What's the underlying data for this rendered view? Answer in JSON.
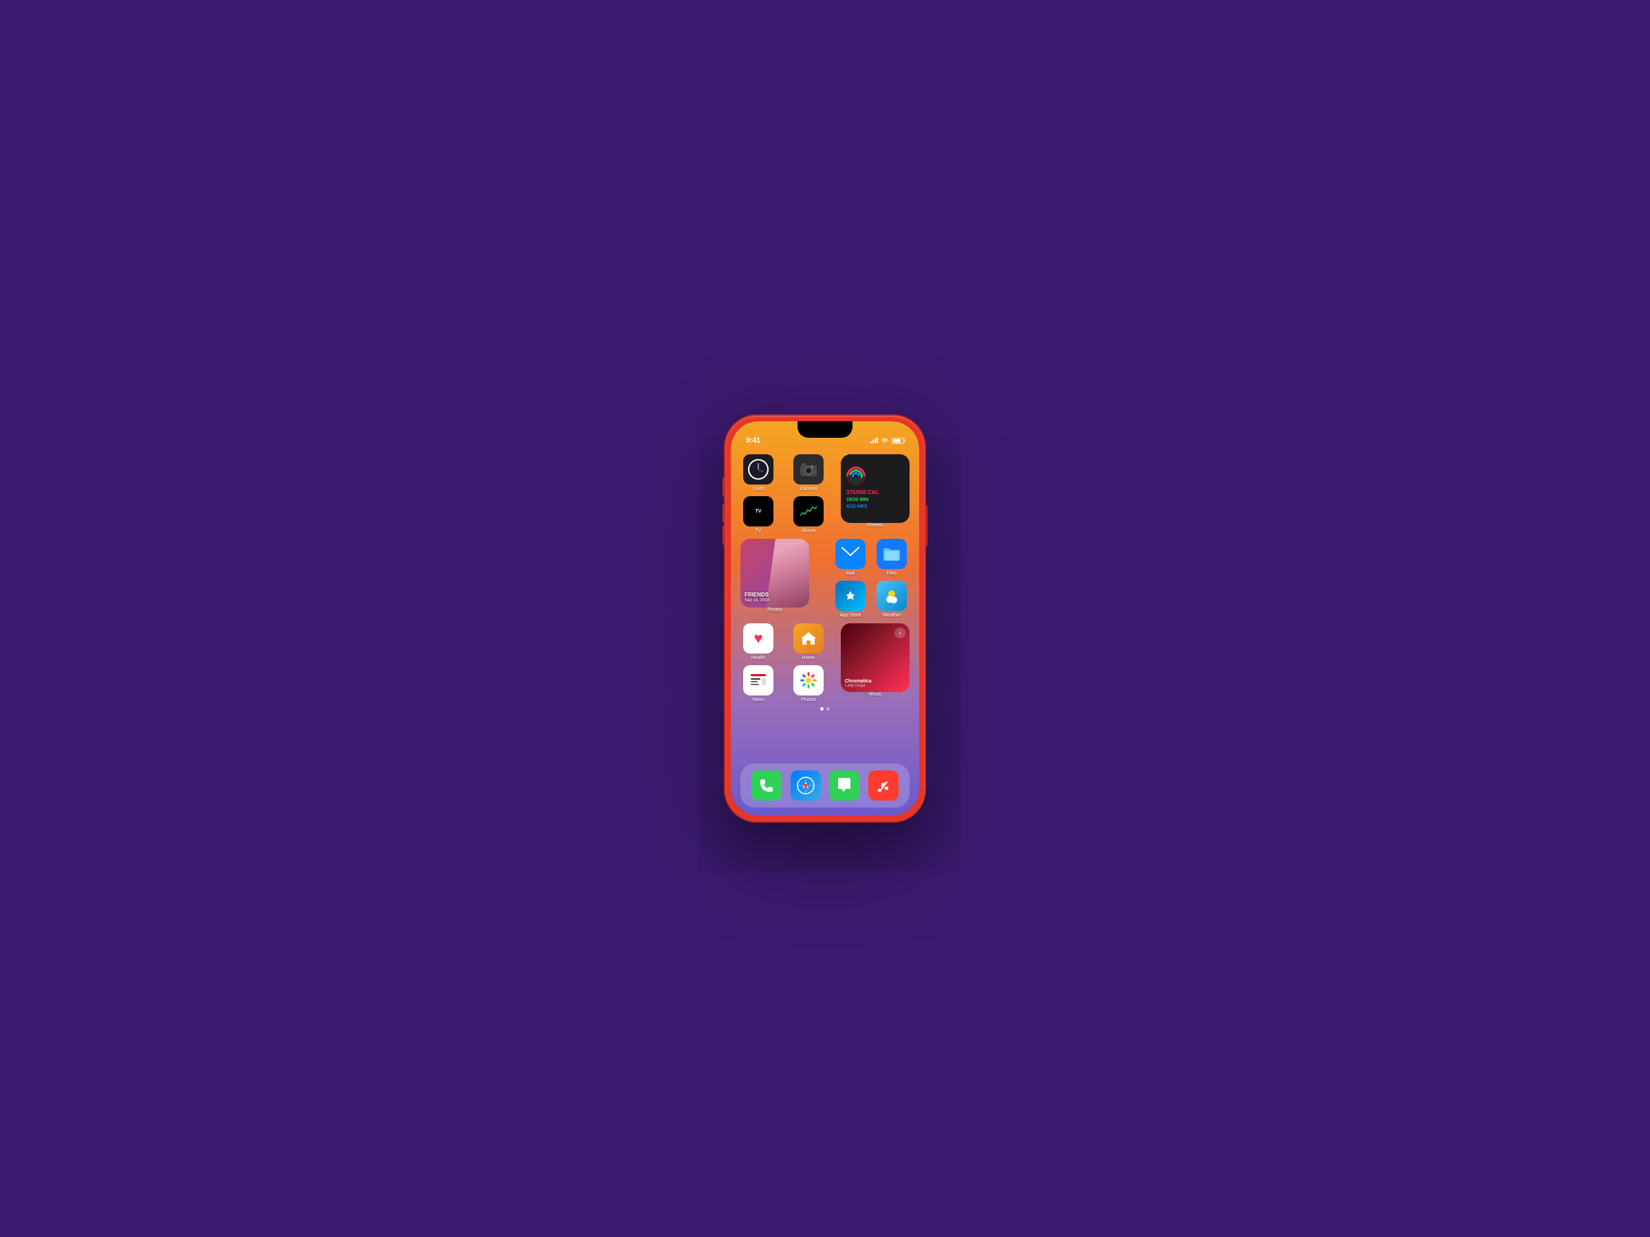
{
  "background_color": "#3a1a6e",
  "phone": {
    "body_color": "#e8352a",
    "status_bar": {
      "time": "9:41",
      "battery_level": 75
    },
    "screen": {
      "gradient_start": "#f5a623",
      "gradient_end": "#6a5acd"
    },
    "apps": {
      "row1": [
        {
          "name": "Clock",
          "label": "Clock",
          "icon_type": "clock"
        },
        {
          "name": "Camera",
          "label": "Camera",
          "icon_type": "camera"
        }
      ],
      "fitness_widget": {
        "label": "Fitness",
        "calories": "375/500",
        "calories_unit": "CAL",
        "minutes": "19/30",
        "minutes_unit": "MIN",
        "hours": "4/12",
        "hours_unit": "HRS"
      },
      "row2": [
        {
          "name": "TV",
          "label": "TV",
          "icon_type": "appletv"
        },
        {
          "name": "Stocks",
          "label": "Stocks",
          "icon_type": "stocks"
        }
      ],
      "photos_widget": {
        "label": "Photos",
        "sublabel": "FRIENDS",
        "date": "Sep 10, 2019"
      },
      "mail": {
        "name": "Mail",
        "label": "Mail",
        "icon_type": "mail"
      },
      "files": {
        "name": "Files",
        "label": "Files",
        "icon_type": "files"
      },
      "appstore": {
        "name": "App Store",
        "label": "App Store",
        "icon_type": "appstore"
      },
      "weather": {
        "name": "Weather",
        "label": "Weather",
        "icon_type": "weather"
      },
      "health": {
        "name": "Health",
        "label": "Health",
        "icon_type": "health"
      },
      "home": {
        "name": "Home",
        "label": "Home",
        "icon_type": "home"
      },
      "music_widget": {
        "label": "Music",
        "song": "Chromatica",
        "artist": "Lady Gaga",
        "icon_type": "music"
      },
      "news": {
        "name": "News",
        "label": "News",
        "icon_type": "news"
      },
      "photos": {
        "name": "Photos",
        "label": "Photos",
        "icon_type": "photos"
      }
    },
    "page_dots": {
      "active_index": 0,
      "total": 2
    },
    "dock": [
      {
        "name": "Phone",
        "icon_type": "phone"
      },
      {
        "name": "Safari",
        "icon_type": "safari"
      },
      {
        "name": "Messages",
        "icon_type": "messages"
      },
      {
        "name": "Music",
        "icon_type": "music"
      }
    ]
  }
}
